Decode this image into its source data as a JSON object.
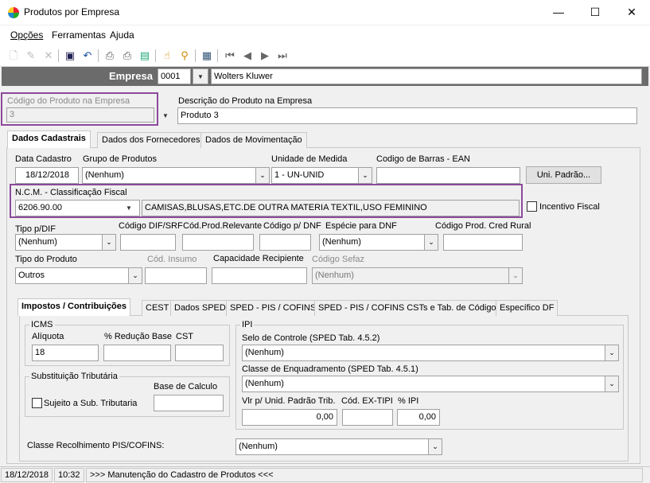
{
  "window": {
    "title": "Produtos por Empresa",
    "minimize": "—",
    "maximize": "☐",
    "close": "✕"
  },
  "menu": [
    "Opções",
    "Ferramentas",
    "Ajuda"
  ],
  "empresa": {
    "label": "Empresa",
    "code": "0001",
    "name": "Wolters Kluwer"
  },
  "produto": {
    "codigo_label": "Código do Produto na Empresa",
    "codigo": "3",
    "descricao_label": "Descrição do Produto na Empresa",
    "descricao": "Produto 3"
  },
  "tabs": [
    "Dados Cadastrais",
    "Dados dos Fornecedores",
    "Dados de Movimentação"
  ],
  "cadastro": {
    "data_label": "Data Cadastro",
    "data": "18/12/2018",
    "grupo_label": "Grupo de Produtos",
    "grupo": "(Nenhum)",
    "unidade_label": "Unidade de Medida",
    "unidade": "1 - UN-UNID",
    "ean_label": "Codigo de Barras - EAN",
    "ean": "",
    "uni_padrao_button": "Uni. Padrão...",
    "ncm_label": "N.C.M. - Classificação Fiscal",
    "ncm": "6206.90.00",
    "ncm_desc": "CAMISAS,BLUSAS,ETC.DE OUTRA MATERIA TEXTIL,USO FEMININO",
    "incentivo_label": "Incentivo Fiscal",
    "tipo_pdif_label": "Tipo p/DIF",
    "tipo_pdif": "(Nenhum)",
    "cod_dif_label": "Código DIF/SRF",
    "cod_prod_rel_label": "Cód.Prod.Relevante",
    "cod_dnf_label": "Código p/ DNF",
    "especie_dnf_label": "Espécie para DNF",
    "especie_dnf": "(Nenhum)",
    "cred_rural_label": "Código Prod. Cred Rural",
    "tipo_produto_label": "Tipo do Produto",
    "tipo_produto": "Outros",
    "cod_insumo_label": "Cód. Insumo",
    "capacidade_label": "Capacidade Recipiente",
    "sefaz_label": "Código Sefaz",
    "sefaz": "(Nenhum)"
  },
  "subtabs": [
    "Impostos / Contribuições",
    "CEST",
    "Dados SPED",
    "SPED - PIS / COFINS",
    "SPED - PIS / COFINS CSTs e Tab. de Códigos",
    "Específico DF"
  ],
  "icms": {
    "title": "ICMS",
    "aliquota_label": "Alíquota",
    "aliquota": "18",
    "reducao_label": "% Redução Base",
    "cst_label": "CST"
  },
  "st": {
    "title": "Substituição Tributária",
    "base_label": "Base de Calculo",
    "sujeito_label": "Sujeito a Sub. Tributaria"
  },
  "ipi": {
    "title": "IPI",
    "selo_label": "Selo de Controle (SPED Tab. 4.5.2)",
    "selo": "(Nenhum)",
    "classe_label": "Classe de Enquadramento (SPED Tab. 4.5.1)",
    "classe": "(Nenhum)",
    "vlr_label": "Vlr p/ Unid. Padrão Trib.",
    "vlr": "0,00",
    "ex_tipi_label": "Cód. EX-TIPI",
    "pct_label": "% IPI",
    "pct": "0,00"
  },
  "pis_cofins": {
    "label": "Classe Recolhimento PIS/COFINS:",
    "value": "(Nenhum)"
  },
  "status": {
    "date": "18/12/2018",
    "time": "10:32",
    "message": ">>> Manutenção do Cadastro de Produtos <<<"
  }
}
